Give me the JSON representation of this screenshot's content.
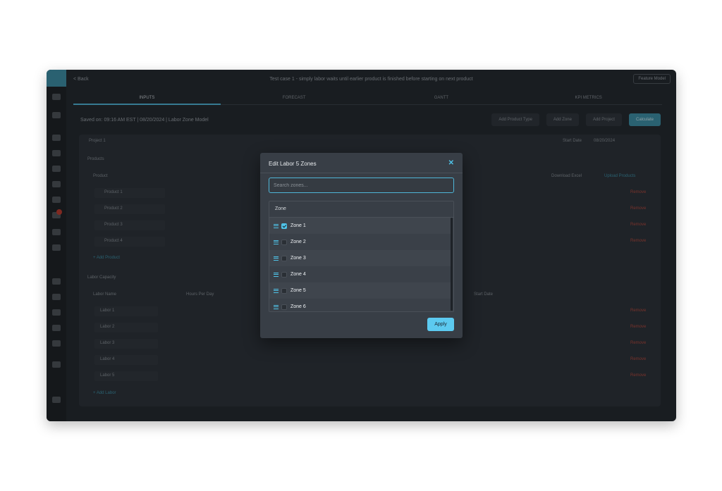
{
  "topbar": {
    "back_label": "< Back",
    "title": "Test case 1 - simply labor waits until earlier product is finished before starting on next product",
    "feature_label": "Feature Model"
  },
  "tabs": [
    "INPUTS",
    "FORECAST",
    "GANTT",
    "KPI METRICS"
  ],
  "subline": "Saved on: 09:16 AM EST | 08/20/2024 | Labor Zone Model",
  "toolbar": [
    "Add Product Type",
    "Add Zone",
    "Add Project",
    "Calculate"
  ],
  "background": {
    "project_label": "Project 1",
    "start_date_label": "Start Date",
    "start_date_value": "08/20/2024",
    "products_title": "Products",
    "product_col": "Product",
    "products": [
      "Product 1",
      "Product 2",
      "Product 3",
      "Product 4"
    ],
    "add_product": "+ Add Product",
    "download_label": "Download Excel",
    "upload_label": "Upload Products",
    "remove_label": "Remove",
    "labor_title": "Labor Capacity",
    "labor_cols": [
      "Labor Name",
      "Hours Per Day",
      "Start Date"
    ],
    "labor": [
      "Labor 1",
      "Labor 2",
      "Labor 3",
      "Labor 4",
      "Labor 5"
    ],
    "add_labor": "+ Add Labor"
  },
  "modal": {
    "title": "Edit Labor 5 Zones",
    "search_placeholder": "Search zones...",
    "column_header": "Zone",
    "zones": [
      {
        "label": "Zone 1",
        "checked": true
      },
      {
        "label": "Zone 2",
        "checked": false
      },
      {
        "label": "Zone 3",
        "checked": false
      },
      {
        "label": "Zone 4",
        "checked": false
      },
      {
        "label": "Zone 5",
        "checked": false
      },
      {
        "label": "Zone 6",
        "checked": false
      }
    ],
    "apply_label": "Apply"
  },
  "colors": {
    "accent": "#4fc3e8",
    "modal_bg": "#383e46",
    "app_bg": "#23272c"
  }
}
